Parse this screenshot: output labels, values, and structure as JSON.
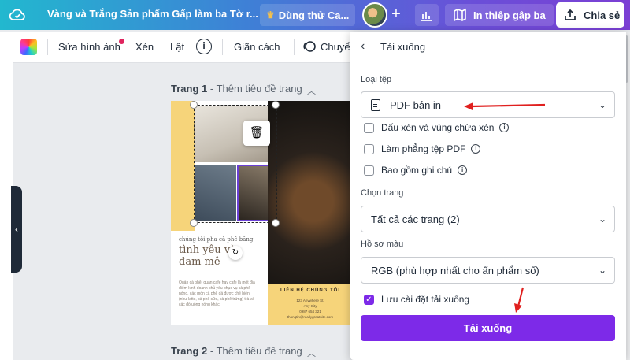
{
  "header": {
    "doc_title": "Vàng và Trắng Sản phẩm Gấp làm ba Tờ r...",
    "try_button": "Dùng thử Ca...",
    "plus_label": "+",
    "print_button": "In thiệp gập ba",
    "share_button": "Chia sẻ"
  },
  "toolbar": {
    "edit_image": "Sửa hình ảnh",
    "crop": "Xén",
    "flip": "Lật",
    "info_label": "i",
    "spacing": "Giãn cách",
    "transform": "Chuyển"
  },
  "canvas": {
    "page1_label_bold": "Trang 1",
    "page1_label_rest": " - Thêm tiêu đề trang",
    "page2_label_bold": "Trang 2",
    "page2_label_rest": " - Thêm tiêu đề trang",
    "flyer": {
      "small_heading": "chúng tôi pha cà phê bằng",
      "script_line1": "tình yêu và",
      "script_line2": "đam mê",
      "body_text": "Quán cà phê, quán cafe hay cafe là một địa điểm kinh doanh chủ yếu phục vụ cà phê nóng, các món cà phê đá được chế biến (như latte, cà phê sữa, cà phê trứng) trà và các đồ uống nóng khác.",
      "contact_heading": "LIÊN HỆ CHÚNG TÔI",
      "contact_lines": [
        "123 Anywhere St.",
        "Any City",
        "0987 654 321",
        "thongtin@reallygreatsite.com"
      ]
    }
  },
  "download_panel": {
    "title": "Tải xuống",
    "file_type_label": "Loại tệp",
    "file_type_value": "PDF bản in",
    "options": [
      {
        "label": "Dấu xén và vùng chừa xén",
        "checked": false
      },
      {
        "label": "Làm phẳng tệp PDF",
        "checked": false
      },
      {
        "label": "Bao gồm ghi chú",
        "checked": false
      }
    ],
    "pages_label": "Chọn trang",
    "pages_value": "Tất cả các trang (2)",
    "color_profile_label": "Hồ sơ màu",
    "color_profile_value": "RGB (phù hợp nhất cho ấn phẩm số)",
    "save_settings_label": "Lưu cài đặt tải xuống",
    "save_settings_checked": true,
    "download_button": "Tải xuống"
  },
  "colors": {
    "accent": "#7d2ae8",
    "annotation": "#e0201f",
    "flyer_yellow": "#f6d47a"
  }
}
